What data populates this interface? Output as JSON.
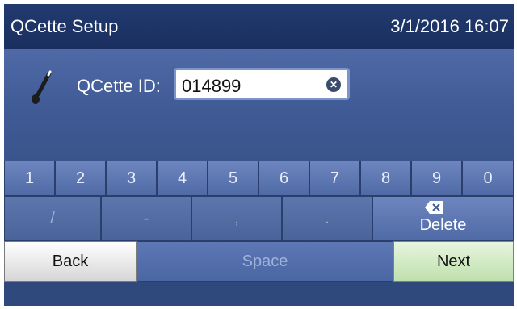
{
  "header": {
    "title": "QCette Setup",
    "datetime": "3/1/2016 16:07"
  },
  "form": {
    "icon": "pen-icon",
    "label": "QCette ID:",
    "value": "014899",
    "clear_icon": "clear-icon"
  },
  "keyboard": {
    "digits": [
      "1",
      "2",
      "3",
      "4",
      "5",
      "6",
      "7",
      "8",
      "9",
      "0"
    ],
    "symbols": [
      "/",
      "-",
      ",",
      "."
    ],
    "delete_label": "Delete",
    "delete_icon": "backspace-icon",
    "back_label": "Back",
    "space_label": "Space",
    "next_label": "Next"
  },
  "colors": {
    "screen": "#3a548c",
    "titlebar": "#1f3566",
    "key": "#5b74ad",
    "next": "#c9e7b8",
    "back": "#f0f0f0"
  }
}
